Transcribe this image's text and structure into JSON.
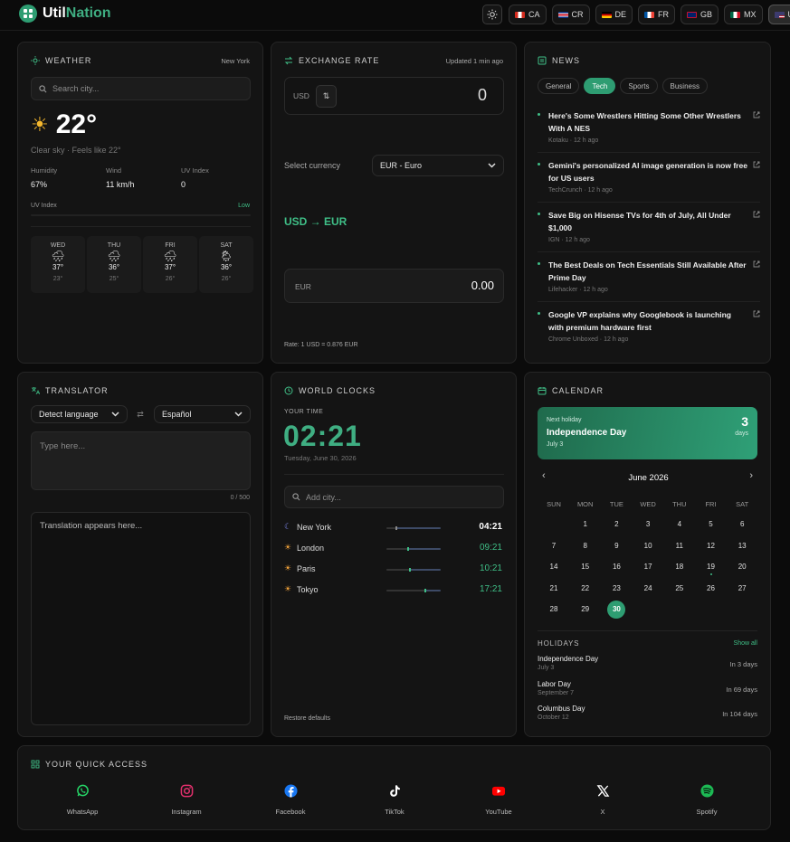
{
  "brand": {
    "part1": "Util",
    "part2": "Nation"
  },
  "countries": [
    {
      "code": "CA",
      "active": false
    },
    {
      "code": "CR",
      "active": false
    },
    {
      "code": "DE",
      "active": false
    },
    {
      "code": "FR",
      "active": false
    },
    {
      "code": "GB",
      "active": false
    },
    {
      "code": "MX",
      "active": false
    },
    {
      "code": "US",
      "active": true
    }
  ],
  "weather": {
    "title": "WEATHER",
    "location": "New York",
    "search_placeholder": "Search city...",
    "temp": "22°",
    "desc": "Clear sky · Feels like 22°",
    "stats": [
      {
        "label": "Humidity",
        "value": "67%"
      },
      {
        "label": "Wind",
        "value": "11 km/h"
      },
      {
        "label": "UV Index",
        "value": "0"
      }
    ],
    "uv_label": "UV Index",
    "uv_level": "Low",
    "forecast": [
      {
        "day": "WED",
        "high": "37°",
        "low": "23°",
        "icon": "rain-cloud-icon"
      },
      {
        "day": "THU",
        "high": "36°",
        "low": "25°",
        "icon": "rain-cloud-icon"
      },
      {
        "day": "FRI",
        "high": "37°",
        "low": "26°",
        "icon": "rain-cloud-icon"
      },
      {
        "day": "SAT",
        "high": "36°",
        "low": "26°",
        "icon": "sun-cloud-rain-icon"
      }
    ]
  },
  "exchange": {
    "title": "EXCHANGE RATE",
    "updated": "Updated 1 min ago",
    "from_code": "USD",
    "from_value": "0",
    "select_label": "Select currency",
    "selected": "EUR - Euro",
    "pair": "USD → EUR",
    "to_code": "EUR",
    "to_value": "0.00",
    "rate": "Rate: 1 USD = 0.876 EUR"
  },
  "news": {
    "title": "NEWS",
    "tabs": [
      "General",
      "Tech",
      "Sports",
      "Business"
    ],
    "active_tab": "Tech",
    "items": [
      {
        "title": "Here's Some Wrestlers Hitting Some Other Wrestlers With A NES",
        "meta": "Kotaku · 12 h ago"
      },
      {
        "title": "Gemini's personalized AI image generation is now free for US users",
        "meta": "TechCrunch · 12 h ago"
      },
      {
        "title": "Save Big on Hisense TVs for 4th of July, All Under $1,000",
        "meta": "IGN · 12 h ago"
      },
      {
        "title": "The Best Deals on Tech Essentials Still Available After Prime Day",
        "meta": "Lifehacker · 12 h ago"
      },
      {
        "title": "Google VP explains why Googlebook is launching with premium hardware first",
        "meta": "Chrome Unboxed · 12 h ago"
      }
    ]
  },
  "translator": {
    "title": "TRANSLATOR",
    "source_lang": "Detect language",
    "target_lang": "Español",
    "input_placeholder": "Type here...",
    "counter": "0 / 500",
    "output_placeholder": "Translation appears here..."
  },
  "clocks": {
    "title": "WORLD CLOCKS",
    "your_time_label": "YOUR TIME",
    "time": "02:21",
    "date": "Tuesday, June 30, 2026",
    "add_placeholder": "Add city...",
    "cities": [
      {
        "name": "New York",
        "time": "04:21",
        "icon": "moon-icon",
        "day_progress": 0.18
      },
      {
        "name": "London",
        "time": "09:21",
        "icon": "sun-icon",
        "day_progress": 0.39
      },
      {
        "name": "Paris",
        "time": "10:21",
        "icon": "sun-icon",
        "day_progress": 0.43
      },
      {
        "name": "Tokyo",
        "time": "17:21",
        "icon": "sun-icon",
        "day_progress": 0.72
      }
    ],
    "restore": "Restore defaults"
  },
  "calendar": {
    "title": "CALENDAR",
    "next_label": "Next holiday",
    "next_name": "Independence Day",
    "next_date": "July 3",
    "next_days": "3",
    "next_days_unit": "days",
    "month": "June 2026",
    "weekdays": [
      "SUN",
      "MON",
      "TUE",
      "WED",
      "THU",
      "FRI",
      "SAT"
    ],
    "weeks": [
      [
        "",
        "1",
        "2",
        "3",
        "4",
        "5",
        "6"
      ],
      [
        "7",
        "8",
        "9",
        "10",
        "11",
        "12",
        "13"
      ],
      [
        "14",
        "15",
        "16",
        "17",
        "18",
        "19",
        "20"
      ],
      [
        "21",
        "22",
        "23",
        "24",
        "25",
        "26",
        "27"
      ],
      [
        "28",
        "29",
        "30",
        "",
        "",
        "",
        ""
      ]
    ],
    "today": "30",
    "marked": "19",
    "holidays_label": "HOLIDAYS",
    "show_all": "Show all",
    "holidays": [
      {
        "name": "Independence Day",
        "date": "July 3",
        "in": "In 3 days"
      },
      {
        "name": "Labor Day",
        "date": "September 7",
        "in": "In 69 days"
      },
      {
        "name": "Columbus Day",
        "date": "October 12",
        "in": "In 104 days"
      }
    ]
  },
  "quick_access": {
    "title": "YOUR QUICK ACCESS",
    "apps": [
      {
        "label": "WhatsApp",
        "icon": "whatsapp-icon",
        "color": "#25d366"
      },
      {
        "label": "Instagram",
        "icon": "instagram-icon",
        "color": "#e1306c"
      },
      {
        "label": "Facebook",
        "icon": "facebook-icon",
        "color": "#1877f2"
      },
      {
        "label": "TikTok",
        "icon": "tiktok-icon",
        "color": "#ffffff"
      },
      {
        "label": "YouTube",
        "icon": "youtube-icon",
        "color": "#ff0000"
      },
      {
        "label": "X",
        "icon": "x-icon",
        "color": "#ffffff"
      },
      {
        "label": "Spotify",
        "icon": "spotify-icon",
        "color": "#1db954"
      }
    ]
  }
}
